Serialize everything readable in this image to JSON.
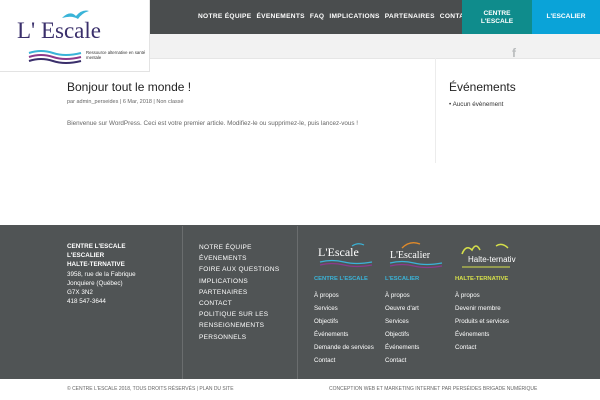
{
  "header": {
    "nav": [
      "NOTRE ÉQUIPE",
      "ÉVENEMENTS",
      "FAQ",
      "IMPLICATIONS",
      "PARTENAIRES",
      "CONTACT"
    ],
    "btn_centre": "CENTRE L'ESCALE",
    "btn_escalier": "L'ESCALIER",
    "facebook": "f"
  },
  "logo": {
    "title": "L' Escale",
    "tagline": "Ressource alternative en santé mentale"
  },
  "post": {
    "title": "Bonjour tout le monde !",
    "meta": "par admin_perseides | 6 Mar, 2018 | Non classé",
    "body": "Bienvenue sur WordPress. Ceci est votre premier article. Modifiez-le ou supprimez-le, puis lancez-vous !"
  },
  "sidebar": {
    "title": "Événements",
    "items": [
      "Aucun évènement"
    ]
  },
  "footer": {
    "contact_names": [
      "CENTRE L'ESCALE",
      "L'ESCALIER",
      "HALTE-TERNATIVE"
    ],
    "address": [
      "3958, rue de la Fabrique",
      "Jonquiere (Québec)",
      "G7X 3N2",
      "418 547-3644"
    ],
    "menu": [
      "NOTRE ÉQUIPE",
      "ÉVENEMENTS",
      "FOIRE AUX QUESTIONS",
      "IMPLICATIONS",
      "PARTENAIRES",
      "CONTACT",
      "POLITIQUE SUR LES",
      "RENSEIGNEMENTS",
      "PERSONNELS"
    ],
    "orgs": [
      {
        "title": "CENTRE L'ESCALE",
        "color": "#3ab4d8",
        "logo": "L'Escale",
        "links": [
          "À propos",
          "Services",
          "Objectifs",
          "Événements",
          "Demande de services",
          "Contact"
        ]
      },
      {
        "title": "L'ESCALIER",
        "color": "#3ab4d8",
        "logo": "L'Escalier",
        "links": [
          "À propos",
          "Oeuvre d'art",
          "Services",
          "Objectifs",
          "Événements",
          "Contact"
        ]
      },
      {
        "title": "HALTE-TERNATIVE",
        "color": "#d6e04a",
        "logo": "Halte-ternative",
        "links": [
          "À propos",
          "Devenir membre",
          "Produits et services",
          "Événements",
          "Contact"
        ]
      }
    ],
    "copyright": "© CENTRE L'ESCALE 2018, TOUS DROITS RÉSERVÉS | PLAN DU SITE",
    "credit": "CONCEPTION WEB ET MARKETING INTERNET PAR PERSÉIDES BRIGADE NUMÉRIQUE"
  },
  "colors": {
    "nav_bg": "#4a4d4e",
    "centre_btn": "#0f8c8c",
    "escalier_btn": "#0aa3d8",
    "footer_bg": "#505455"
  }
}
